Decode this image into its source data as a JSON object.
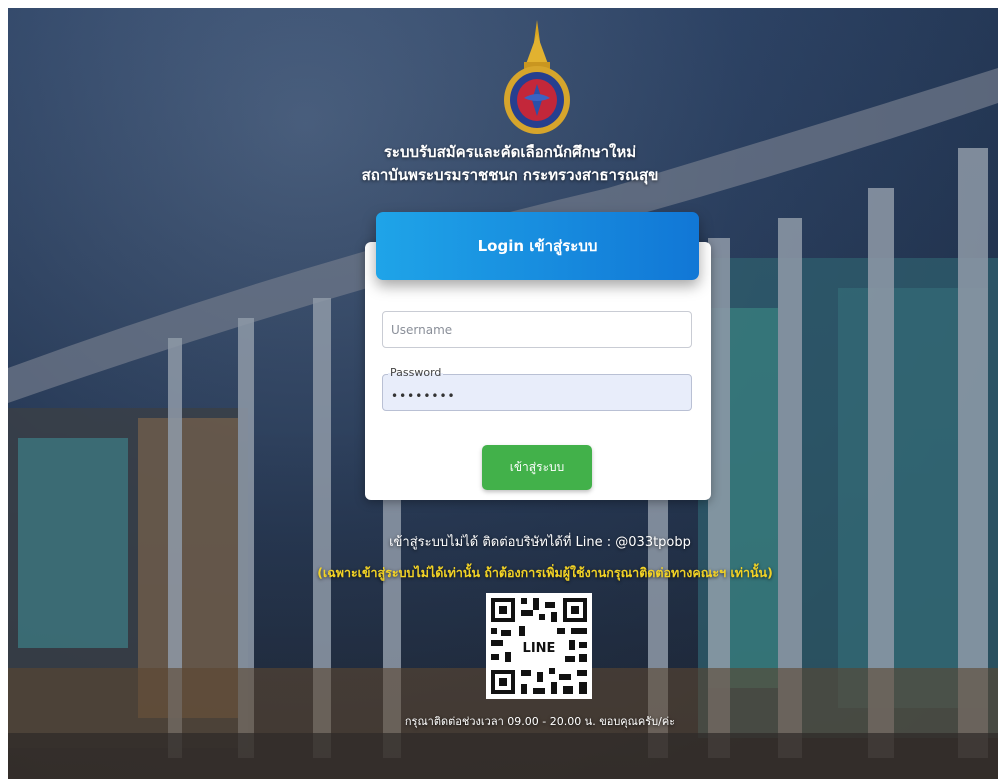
{
  "header": {
    "title_line1": "ระบบรับสมัครและคัดเลือกนักศึกษาใหม่",
    "title_line2": "สถาบันพระบรมราชชนก กระทรวงสาธารณสุข"
  },
  "login": {
    "heading": "Login เข้าสู่ระบบ",
    "username_placeholder": "Username",
    "username_value": "",
    "password_label": "Password",
    "password_value": "••••••••",
    "submit_label": "เข้าสู่ระบบ"
  },
  "contact": {
    "line_text": "เข้าสู่ระบบไม่ได้ ติดต่อบริษัทได้ที่ Line : @033tpobp",
    "note": "(เฉพาะเข้าสู่ระบบไม่ได้เท่านั้น ถ้าต้องการเพิ่มผู้ใช้งานกรุณาติดต่อทางคณะฯ เท่านั้น)",
    "qr_label": "LINE",
    "hours": "กรุณาติดต่อช่วงเวลา 09.00 - 20.00 น. ขอบคุณครับ/ค่ะ"
  },
  "colors": {
    "header_gradient_start": "#1fa4e8",
    "header_gradient_end": "#1177d6",
    "button": "#42b14a",
    "note_text": "#f2d225"
  },
  "icons": {
    "logo": "institution-emblem-icon",
    "qr": "line-qr-code-icon"
  }
}
